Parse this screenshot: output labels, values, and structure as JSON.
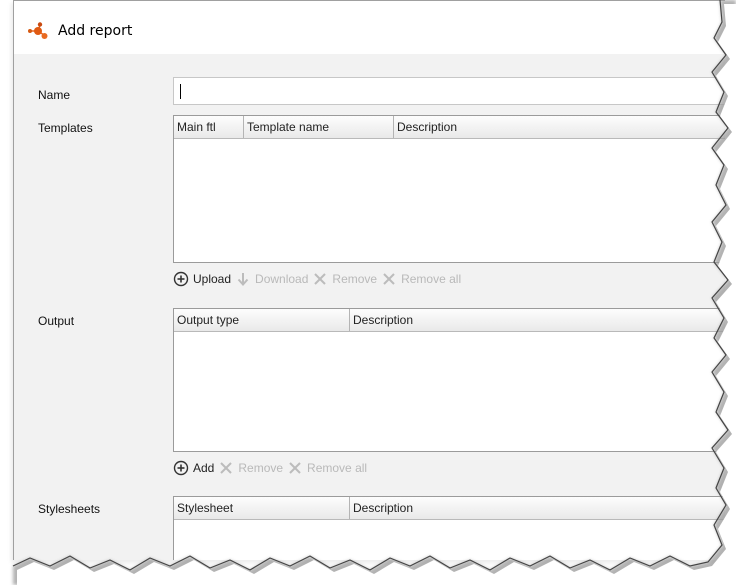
{
  "dialog": {
    "title": "Add report",
    "icon": "molecule-icon"
  },
  "form": {
    "name": {
      "label": "Name",
      "value": ""
    },
    "templates": {
      "label": "Templates",
      "columns": [
        "Main ftl",
        "Template name",
        "Description"
      ],
      "rows": [],
      "actions": [
        {
          "label": "Upload",
          "icon": "plus-circle-icon",
          "enabled": true
        },
        {
          "label": "Download",
          "icon": "download-arrow-icon",
          "enabled": false
        },
        {
          "label": "Remove",
          "icon": "x-icon",
          "enabled": false
        },
        {
          "label": "Remove all",
          "icon": "x-icon",
          "enabled": false
        }
      ]
    },
    "output": {
      "label": "Output",
      "columns": [
        "Output type",
        "Description"
      ],
      "rows": [],
      "actions": [
        {
          "label": "Add",
          "icon": "plus-circle-icon",
          "enabled": true
        },
        {
          "label": "Remove",
          "icon": "x-icon",
          "enabled": false
        },
        {
          "label": "Remove all",
          "icon": "x-icon",
          "enabled": false
        }
      ]
    },
    "stylesheets": {
      "label": "Stylesheets",
      "columns": [
        "Stylesheet",
        "Description"
      ],
      "rows": []
    }
  },
  "colors": {
    "accent_orange": "#e8641e",
    "disabled_text": "#b9b9b9"
  }
}
